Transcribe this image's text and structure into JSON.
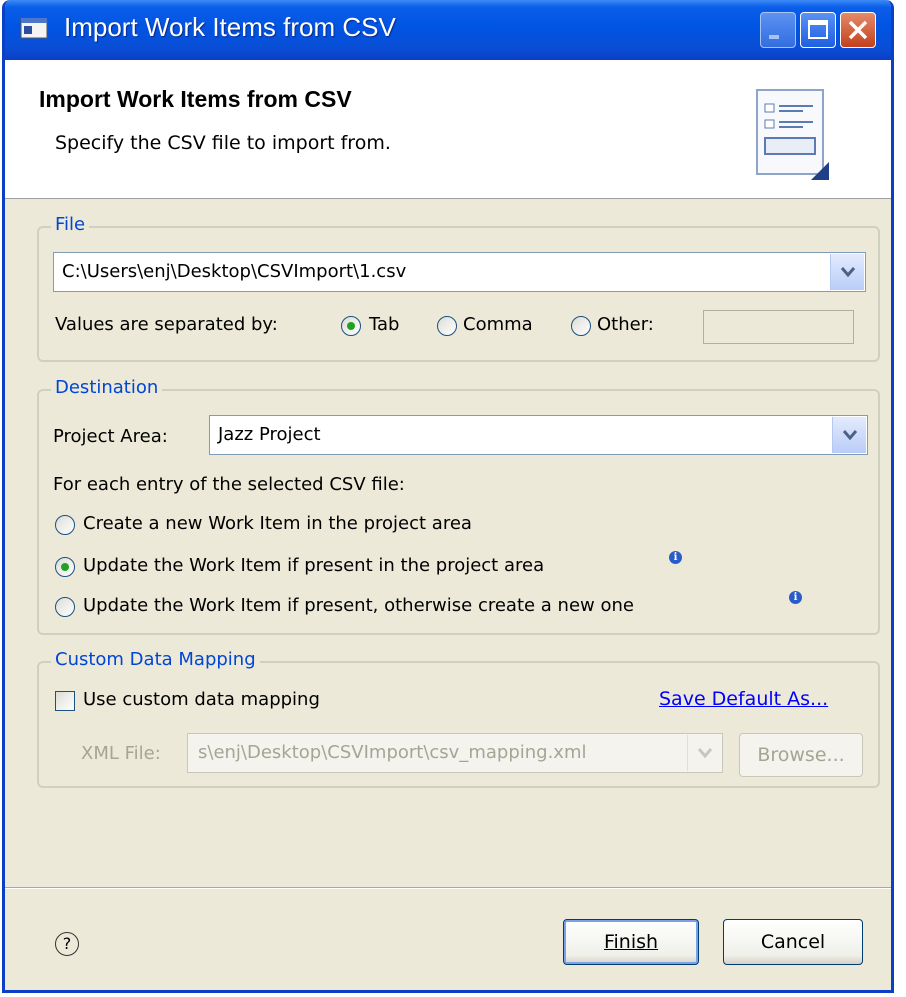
{
  "window": {
    "title": "Import Work Items from CSV",
    "icons": {
      "app": "import-icon",
      "minimize": "minimize-icon",
      "maximize": "maximize-icon",
      "close": "close-icon"
    }
  },
  "banner": {
    "title": "Import Work Items from CSV",
    "description": "Specify the CSV file to import from.",
    "icon": "wizard-form-icon"
  },
  "file_group": {
    "legend": "File",
    "path_value": "C:\\Users\\enj\\Desktop\\CSVImport\\1.csv",
    "separator_label": "Values are separated by:",
    "separators": [
      {
        "label": "Tab",
        "selected": true
      },
      {
        "label": "Comma",
        "selected": false
      },
      {
        "label": "Other:",
        "selected": false
      }
    ],
    "other_value": ""
  },
  "destination_group": {
    "legend": "Destination",
    "project_area_label": "Project Area:",
    "project_area_value": "Jazz Project",
    "entry_label": "For each entry of the selected CSV file:",
    "options": [
      {
        "label": "Create a new Work Item in the project area",
        "selected": false
      },
      {
        "label": "Update the Work Item if present in the project area",
        "selected": true
      },
      {
        "label": "Update the Work Item if present, otherwise create a new one",
        "selected": false
      }
    ]
  },
  "custom_group": {
    "legend": "Custom Data Mapping",
    "checkbox_label": "Use custom data mapping",
    "checkbox_checked": false,
    "save_default_link": "Save Default As...",
    "xml_label": "XML File:",
    "xml_value": "s\\enj\\Desktop\\CSVImport\\csv_mapping.xml",
    "browse_label": "Browse..."
  },
  "footer": {
    "help_icon": "help-icon",
    "finish_label": "Finish",
    "cancel_label": "Cancel"
  },
  "colors": {
    "titlebar": "#0054e3",
    "dialog_bg": "#ece9d8",
    "legend": "#0046d5",
    "link": "#0000ff"
  }
}
